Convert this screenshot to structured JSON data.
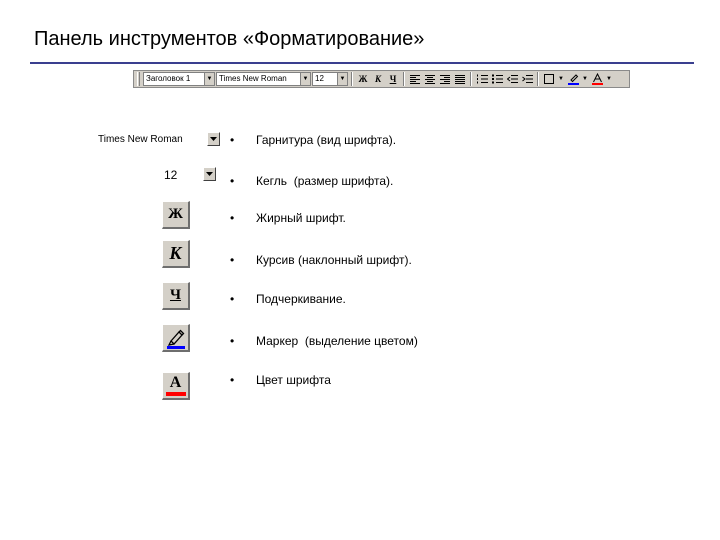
{
  "slide": {
    "title": "Панель инструментов «Форматирование»"
  },
  "toolbar": {
    "style_value": "Заголовок 1",
    "font_value": "Times New Roman",
    "size_value": "12",
    "bold_label": "Ж",
    "italic_label": "К",
    "underline_label": "Ч"
  },
  "controls": {
    "font_combo_value": "Times New Roman",
    "size_combo_value": "12",
    "bold_label": "Ж",
    "italic_label": "К",
    "underline_label": "Ч",
    "color_label": "А",
    "highlight_color": "#0000ff",
    "font_color": "#ff0000"
  },
  "items": [
    {
      "bullet": "•",
      "text": "Гарнитура (вид шрифта)."
    },
    {
      "bullet": "•",
      "text": "Кегль  (размер шрифта)."
    },
    {
      "bullet": "•",
      "text": "Жирный шрифт."
    },
    {
      "bullet": "•",
      "text": "Курсив (наклонный шрифт)."
    },
    {
      "bullet": "•",
      "text": "Подчеркивание."
    },
    {
      "bullet": "•",
      "text": "Маркер  (выделение цветом)"
    },
    {
      "bullet": "•",
      "text": "Цвет шрифта"
    }
  ]
}
